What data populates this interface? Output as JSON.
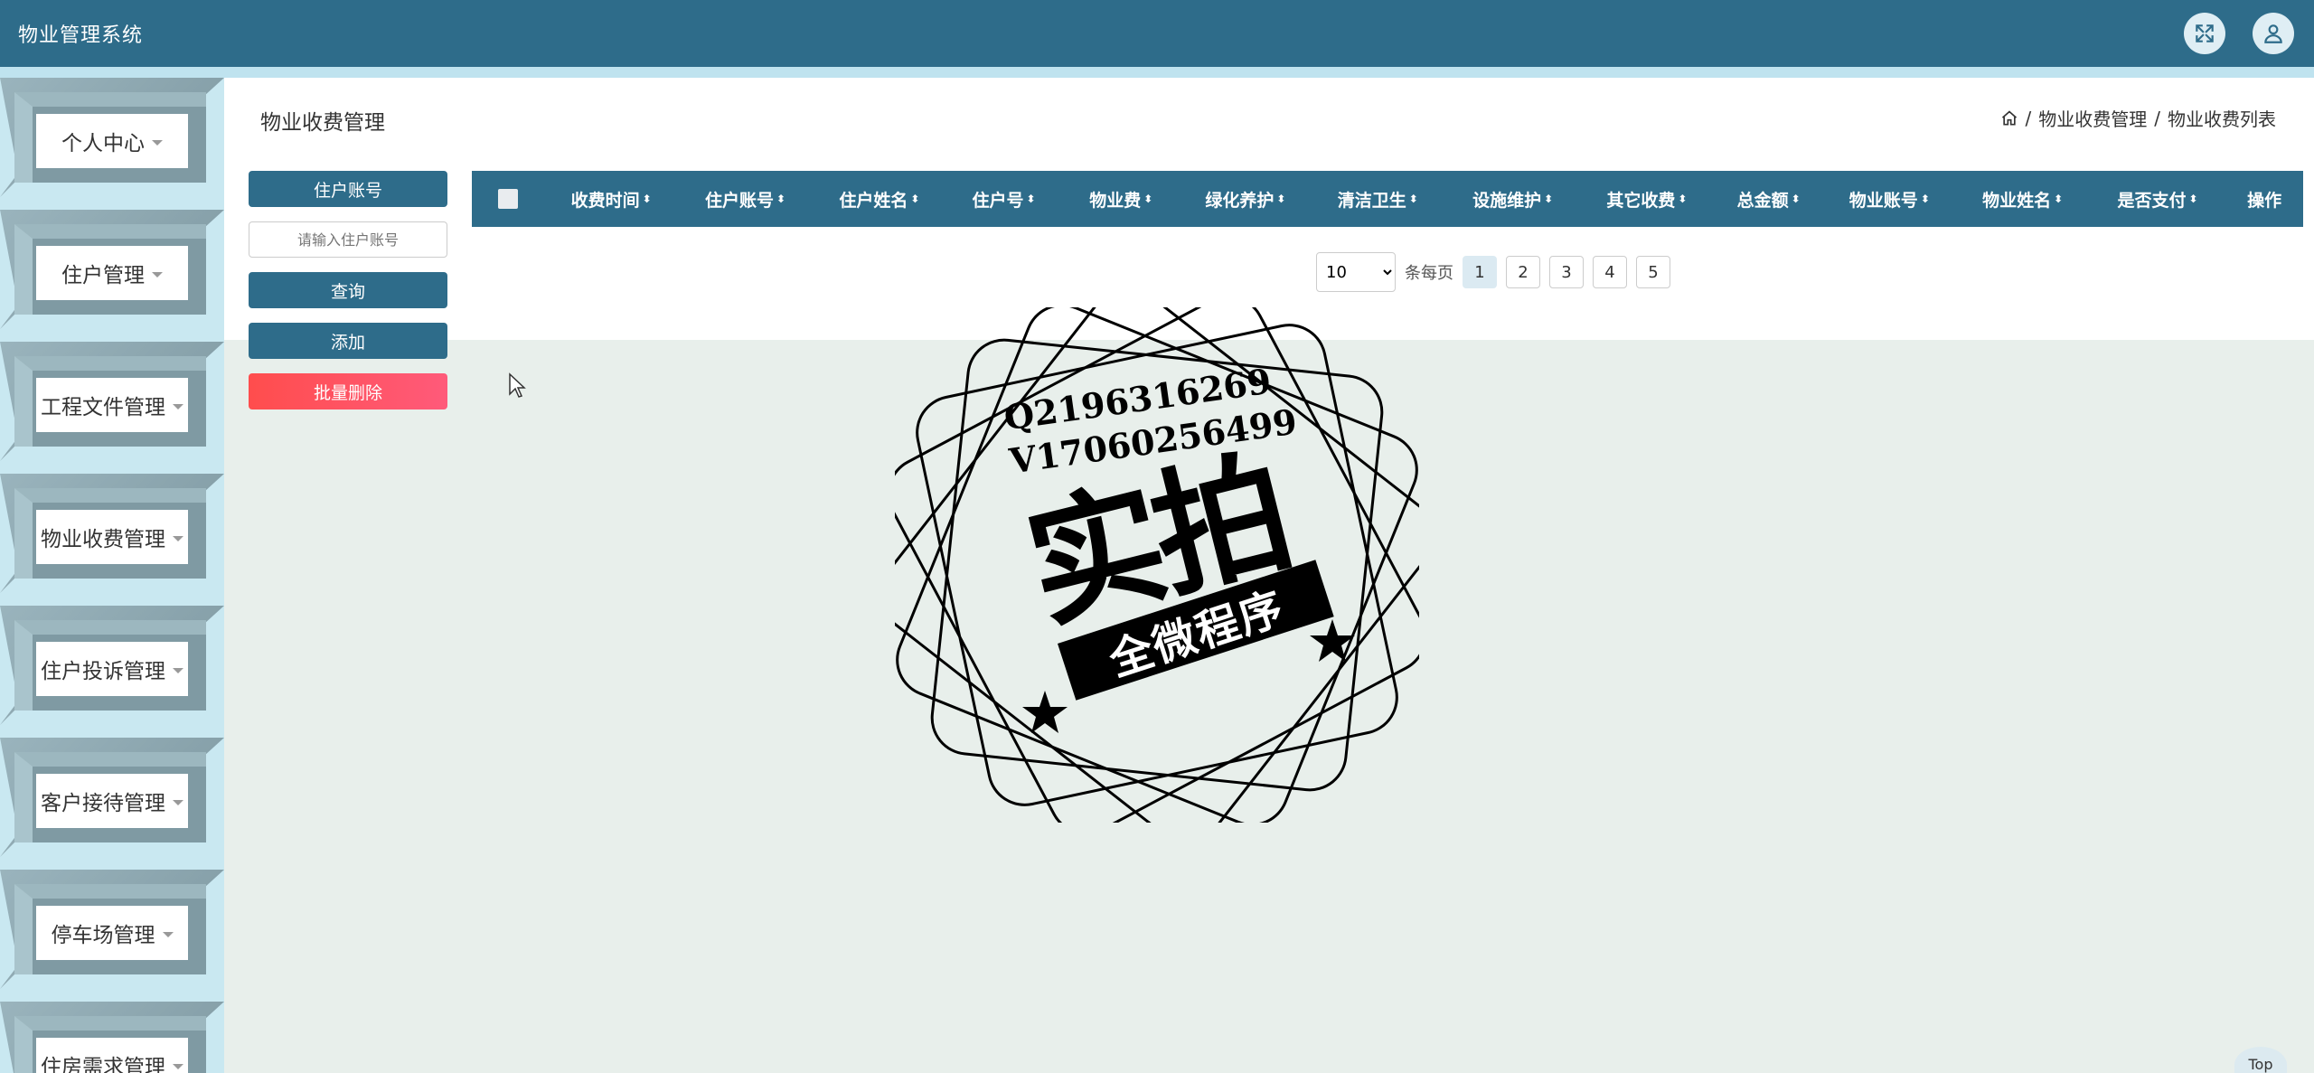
{
  "app": {
    "title": "物业管理系统"
  },
  "header": {
    "icons": [
      "fullscreen-icon",
      "user-icon"
    ]
  },
  "sidebar": {
    "items": [
      {
        "label": "个人中心"
      },
      {
        "label": "住户管理"
      },
      {
        "label": "工程文件管理"
      },
      {
        "label": "物业收费管理"
      },
      {
        "label": "住户投诉管理"
      },
      {
        "label": "客户接待管理"
      },
      {
        "label": "停车场管理"
      },
      {
        "label": "住房需求管理"
      }
    ]
  },
  "main": {
    "title": "物业收费管理",
    "breadcrumb": {
      "level1": "物业收费管理",
      "level2": "物业收费列表",
      "sep": "/"
    },
    "search": {
      "label": "住户账号",
      "placeholder": "请输入住户账号"
    },
    "buttons": {
      "query": "查询",
      "add": "添加",
      "batch_delete": "批量删除"
    },
    "table": {
      "columns": [
        "收费时间",
        "住户账号",
        "住户姓名",
        "住户号",
        "物业费",
        "绿化养护",
        "清洁卫生",
        "设施维护",
        "其它收费",
        "总金额",
        "物业账号",
        "物业姓名",
        "是否支付",
        "操作"
      ],
      "sort_glyph": "⬍"
    },
    "pager": {
      "page_size": "10",
      "per_page_label": "条每页",
      "pages": [
        "1",
        "2",
        "3",
        "4",
        "5"
      ],
      "active": "1"
    }
  },
  "watermark": {
    "line1": "Q2196316269",
    "line2": "V17060256499",
    "big": "实拍",
    "banner": "全微程序"
  },
  "back_to_top": "Top",
  "colors": {
    "primary": "#2e6c8a",
    "danger": "#ff4d4d",
    "background": "#e8efeb"
  }
}
